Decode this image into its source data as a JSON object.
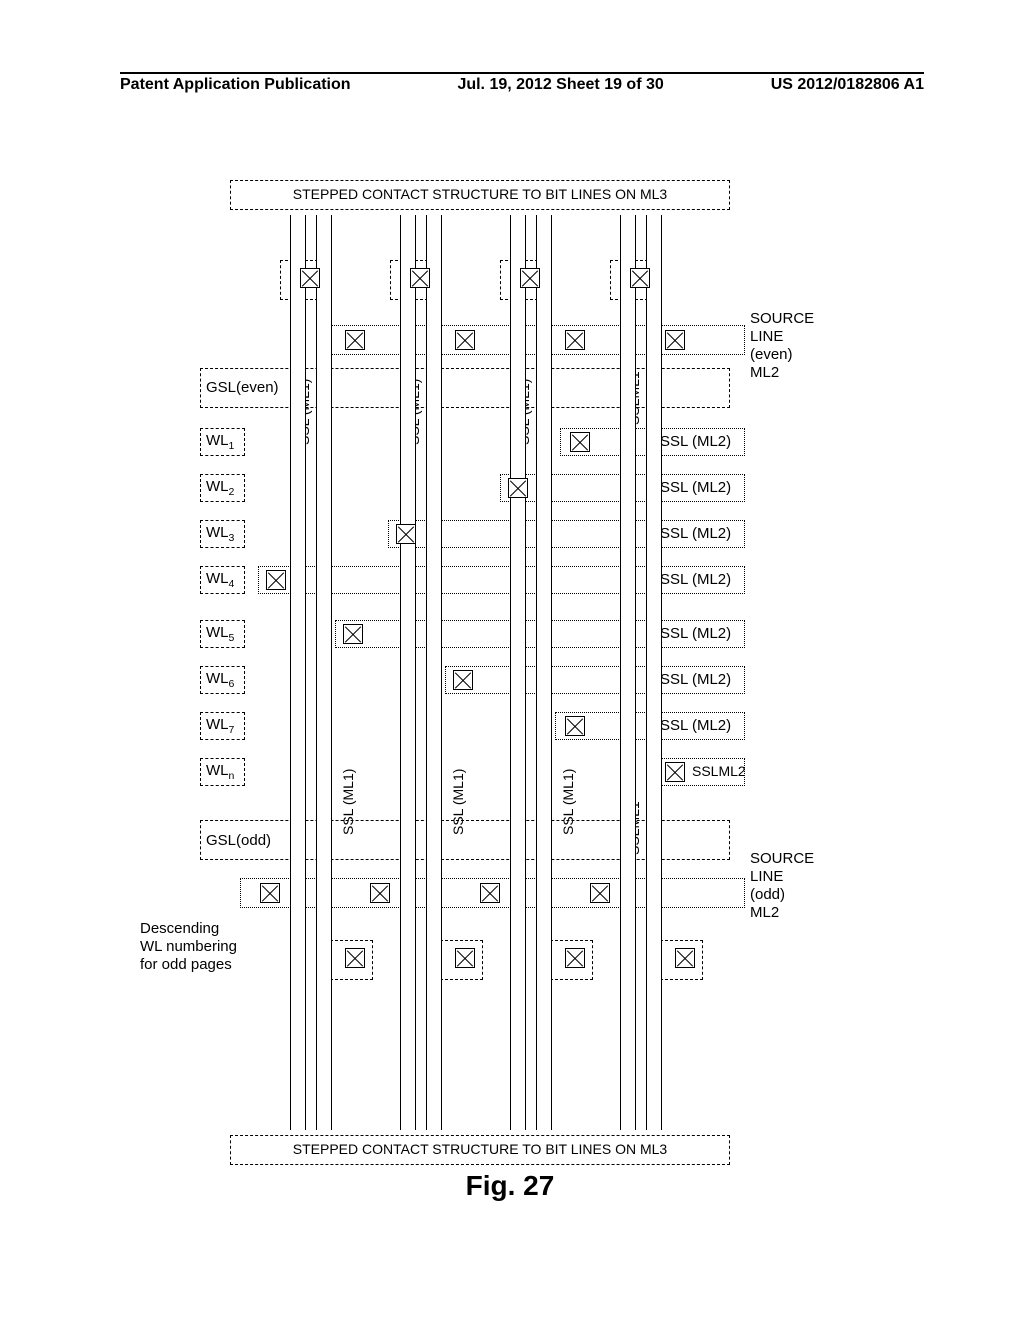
{
  "header": {
    "left": "Patent Application Publication",
    "mid": "Jul. 19, 2012  Sheet 19 of 30",
    "right": "US 2012/0182806 A1"
  },
  "top_band": "STEPPED CONTACT STRUCTURE TO BIT LINES ON ML3",
  "bottom_band": "STEPPED CONTACT STRUCTURE TO BIT LINES ON ML3",
  "source_even_a": "SOURCE",
  "source_even_b": "LINE",
  "source_even_c": "(even)",
  "source_even_d": "ML2",
  "source_odd_a": "SOURCE",
  "source_odd_b": "LINE",
  "source_odd_c": "(odd)",
  "source_odd_d": "ML2",
  "gsl_even": "GSL(even)",
  "gsl_odd": "GSL(odd)",
  "wl1": "WL",
  "wl1s": "1",
  "wl2": "WL",
  "wl2s": "2",
  "wl3": "WL",
  "wl3s": "3",
  "wl4": "WL",
  "wl4s": "4",
  "wl5": "WL",
  "wl5s": "5",
  "wl6": "WL",
  "wl6s": "6",
  "wl7": "WL",
  "wl7s": "7",
  "wln": "WL",
  "wlns": "n",
  "ssl_ml2": "SSL (ML2)",
  "ssl_ml2_short": "SSLML2",
  "ssl_ml1": "SSL (ML1)",
  "ssl_ml1_short": "SSLML1",
  "desc1": "Descending",
  "desc2": "WL numbering",
  "desc3": "for odd pages",
  "fig": "Fig. 27"
}
